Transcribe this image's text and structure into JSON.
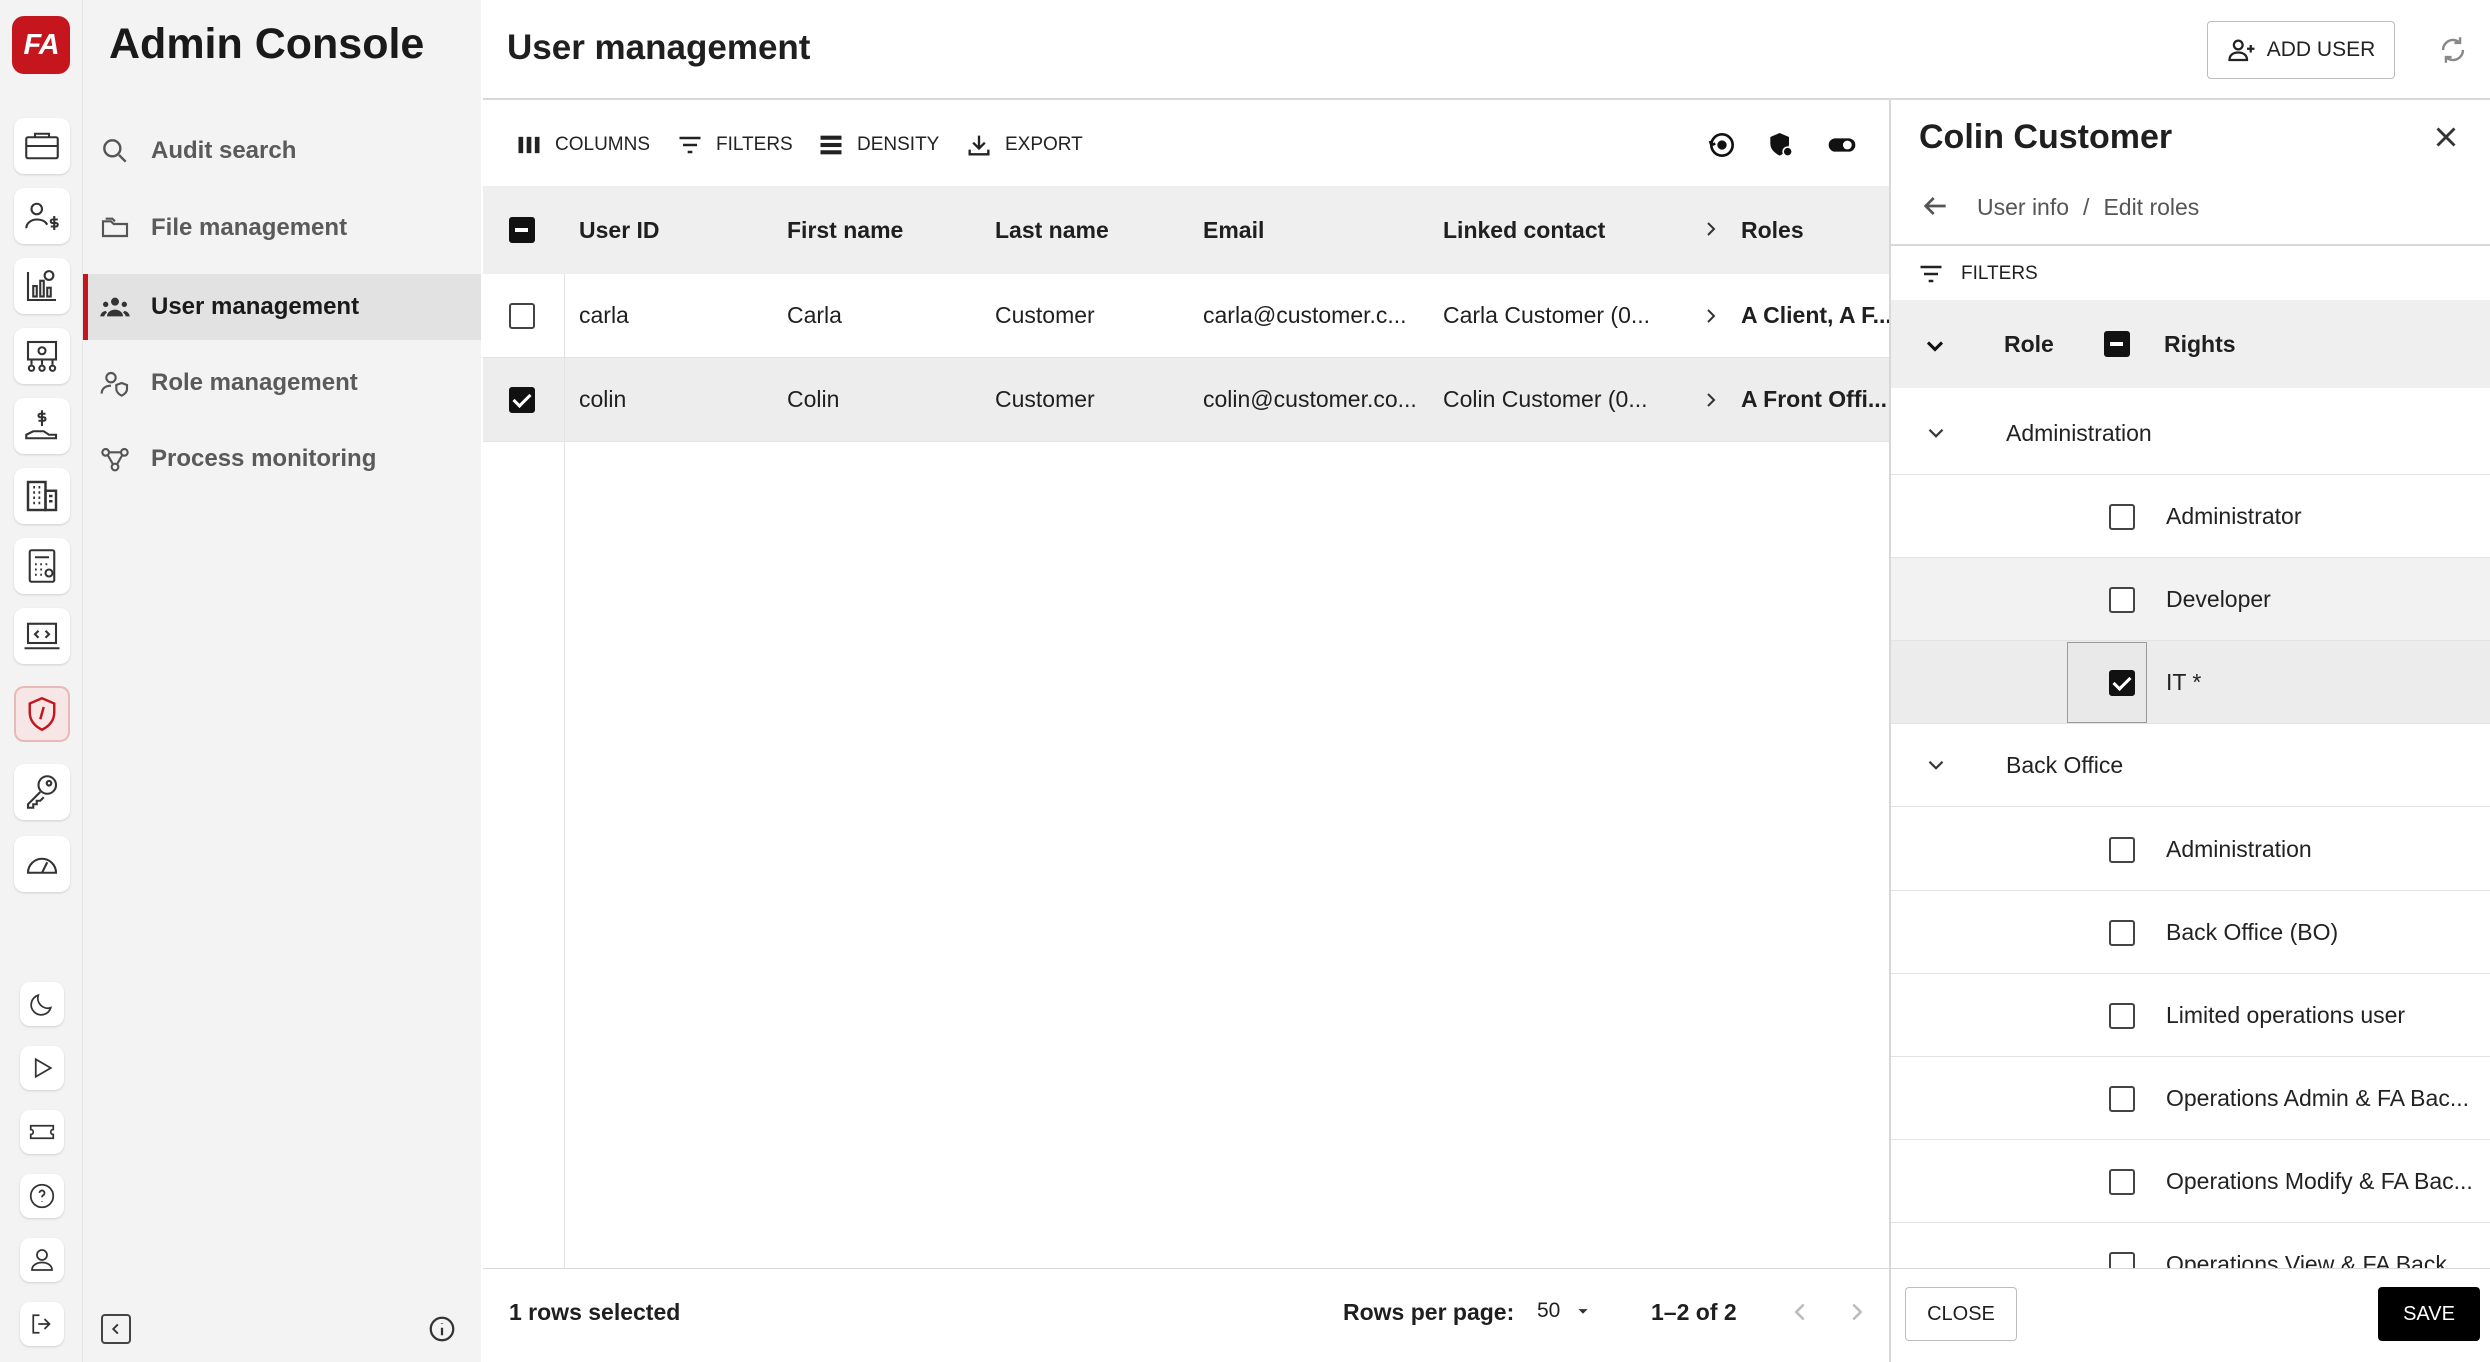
{
  "app": {
    "logo_text": "FA",
    "title": "Admin Console"
  },
  "rail": {
    "icons": [
      "portfolio-icon",
      "client-money-icon",
      "analytics-icon",
      "org-chart-icon",
      "payments-icon",
      "building-icon",
      "calculator-icon",
      "code-icon",
      "shield-icon",
      "key-icon",
      "gauge-icon"
    ],
    "bottom_icons": [
      "moon-icon",
      "play-icon",
      "ticket-icon",
      "help-icon",
      "user-icon",
      "logout-icon"
    ],
    "active": "shield-icon"
  },
  "nav": {
    "items": [
      {
        "label": "Audit search",
        "icon": "search-icon"
      },
      {
        "label": "File management",
        "icon": "folders-icon"
      },
      {
        "label": "User management",
        "icon": "users-icon",
        "active": true
      },
      {
        "label": "Role management",
        "icon": "user-shield-icon"
      },
      {
        "label": "Process monitoring",
        "icon": "process-icon"
      }
    ]
  },
  "header": {
    "title": "User management",
    "add_user_label": "ADD USER"
  },
  "toolbar": {
    "columns": "COLUMNS",
    "filters": "FILTERS",
    "density": "DENSITY",
    "export": "EXPORT"
  },
  "table": {
    "headers": [
      "User ID",
      "First name",
      "Last name",
      "Email",
      "Linked contact",
      "Roles"
    ],
    "rows": [
      {
        "selected": false,
        "user_id": "carla",
        "first": "Carla",
        "last": "Customer",
        "email": "carla@customer.c...",
        "contact": "Carla Customer (0...",
        "roles": "A Client, A F..."
      },
      {
        "selected": true,
        "user_id": "colin",
        "first": "Colin",
        "last": "Customer",
        "email": "colin@customer.co...",
        "contact": "Colin Customer (0...",
        "roles": "A Front Offi..."
      }
    ]
  },
  "footer": {
    "selected_text": "1 rows selected",
    "rows_per_page_label": "Rows per page:",
    "rows_per_page_value": "50",
    "range": "1–2 of 2"
  },
  "drawer": {
    "title": "Colin Customer",
    "breadcrumb": {
      "parent": "User info",
      "separator": "/",
      "current": "Edit roles"
    },
    "filters_label": "FILTERS",
    "headers": {
      "role": "Role",
      "rights": "Rights"
    },
    "groups": [
      {
        "name": "Administration",
        "rights": [
          {
            "label": "Administrator",
            "checked": false
          },
          {
            "label": "Developer",
            "checked": false
          },
          {
            "label": "IT *",
            "checked": true
          }
        ]
      },
      {
        "name": "Back Office",
        "rights": [
          {
            "label": "Administration",
            "checked": false
          },
          {
            "label": "Back Office (BO)",
            "checked": false
          },
          {
            "label": "Limited operations user",
            "checked": false
          },
          {
            "label": "Operations Admin & FA Bac...",
            "checked": false
          },
          {
            "label": "Operations Modify & FA Bac...",
            "checked": false
          },
          {
            "label": "Operations View & FA Back ...",
            "checked": false
          }
        ]
      }
    ],
    "close_label": "CLOSE",
    "save_label": "SAVE"
  },
  "colors": {
    "accent": "#c4161c",
    "text": "#1f1f1f",
    "muted": "#5a5a5a"
  }
}
